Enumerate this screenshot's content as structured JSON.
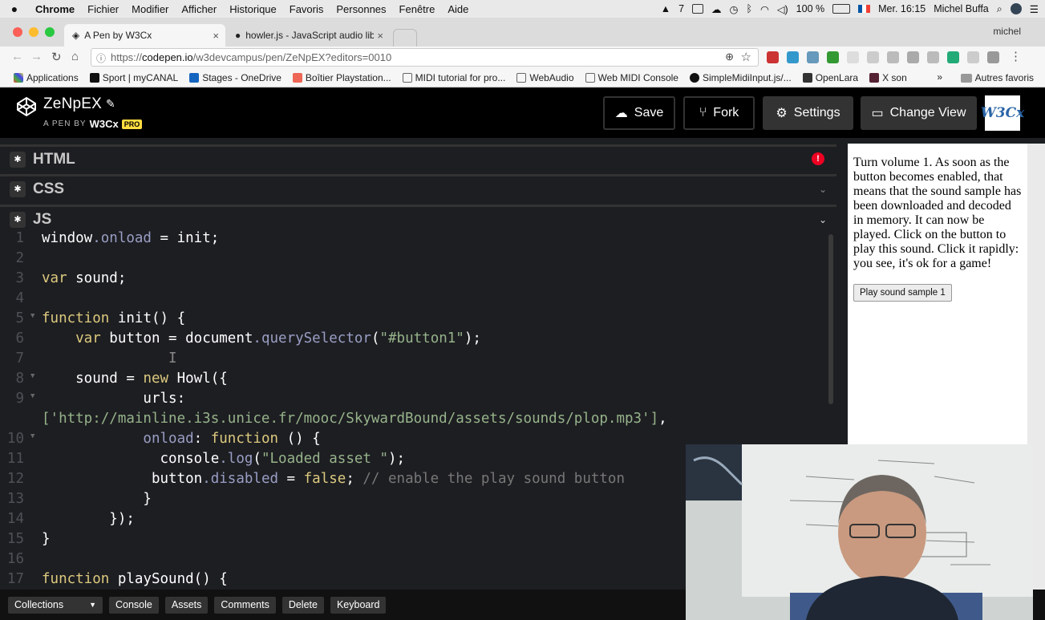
{
  "menubar": {
    "apple": "",
    "items": [
      "Chrome",
      "Fichier",
      "Modifier",
      "Afficher",
      "Historique",
      "Favoris",
      "Personnes",
      "Fenêtre",
      "Aide"
    ],
    "status_count": "7",
    "battery": "100 %",
    "clock": "Mer. 16:15",
    "user": "Michel Buffa"
  },
  "tabs": [
    {
      "title": "A Pen by W3Cx"
    },
    {
      "title": "howler.js - JavaScript audio lib"
    }
  ],
  "profile": "michel",
  "omnibox": {
    "scheme": "https://",
    "host": "codepen.io",
    "path": "/w3devcampus/pen/ZeNpEX?editors=0010"
  },
  "bookmarks": [
    "Applications",
    "Sport | myCANAL",
    "Stages - OneDrive",
    "Boîtier Playstation...",
    "MIDI tutorial for pro...",
    "WebAudio",
    "Web MIDI Console",
    "SimpleMidiInput.js/...",
    "OpenLara",
    "X son"
  ],
  "bookmarks_more": "»",
  "bookmarks_other": "Autres favoris",
  "codepen": {
    "title": "ZeNpEX",
    "byline": "A PEN BY",
    "owner": "W3Cx",
    "badge": "PRO",
    "buttons": {
      "save": "Save",
      "fork": "Fork",
      "settings": "Settings",
      "change_view": "Change View"
    },
    "avatar_text": "W3Cx"
  },
  "panels": {
    "html": "HTML",
    "css": "CSS",
    "js": "JS"
  },
  "code_lines": [
    "1",
    "2",
    "3",
    "4",
    "5",
    "6",
    "7",
    "8",
    "9",
    "",
    "10",
    "11",
    "12",
    "13",
    "14",
    "15",
    "16",
    "17"
  ],
  "code_text": {
    "l1": "window",
    "l1b": ".onload",
    "l1c": " = init;",
    "l3": "var",
    "l3b": " sound;",
    "l5": "function",
    "l5b": " init() {",
    "l6a": "    var",
    "l6b": " button = document",
    "l6c": ".querySelector",
    "l6d": "(",
    "l6e": "\"#button1\"",
    "l6f": ");",
    "l8a": "    sound = ",
    "l8b": "new",
    "l8c": " Howl({",
    "l9": "            urls:",
    "l9b": "['http://mainline.i3s.unice.fr/mooc/SkywardBound/assets/sounds/plop.mp3']",
    "l9c": ",",
    "l10a": "            onload",
    "l10b": ": ",
    "l10c": "function",
    "l10d": " () {",
    "l11a": "              console",
    "l11b": ".log",
    "l11c": "(",
    "l11d": "\"Loaded asset \"",
    "l11e": ");",
    "l12a": "             button",
    "l12b": ".disabled",
    "l12c": " = ",
    "l12d": "false",
    "l12e": "; ",
    "l12f": "// enable the play sound button",
    "l13": "            }",
    "l14": "        });",
    "l15": "}",
    "l17a": "function",
    "l17b": " playSound() {"
  },
  "preview": {
    "text": "Turn volume 1. As soon as the button becomes enabled, that means that the sound sample has been downloaded and decoded in memory. It can now be played. Click on the button to play this sound. Click it rapidly: you see, it's ok for a game!",
    "button": "Play sound sample 1"
  },
  "footer": {
    "collections": "Collections",
    "buttons": [
      "Console",
      "Assets",
      "Comments",
      "Delete",
      "Keyboard"
    ]
  }
}
